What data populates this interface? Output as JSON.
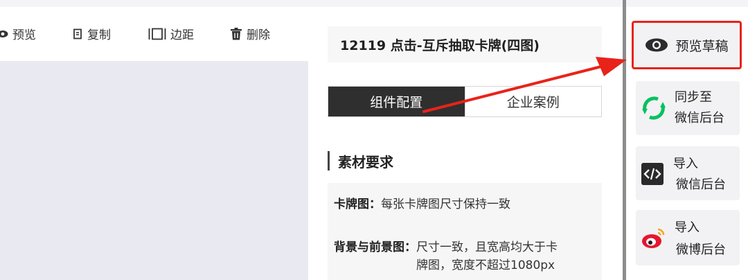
{
  "toolbar": {
    "preview": "预览",
    "copy": "复制",
    "margin": "边距",
    "delete": "删除"
  },
  "title": "12119 点击-互斥抽取卡牌(四图)",
  "tabs": {
    "config": "组件配置",
    "cases": "企业案例"
  },
  "section": {
    "title": "素材要求"
  },
  "requirements": {
    "card_label": "卡牌图：",
    "card_text": "每张卡牌图尺寸保持一致",
    "bg_label": "背景与前景图：",
    "bg_text_1": "尺寸一致，且宽高均大于卡",
    "bg_text_2": "牌图，宽度不超过1080px"
  },
  "sidebar": {
    "preview_draft": "预览草稿",
    "sync_line1": "同步至",
    "sync_line2": "微信后台",
    "import_line1": "导入",
    "import_line2": "微信后台",
    "weibo_line1": "导入",
    "weibo_line2": "微博后台"
  },
  "colors": {
    "highlight": "#e8231a",
    "active_tab": "#2f2f2f",
    "wechat_green": "#07c160",
    "weibo_red": "#e6162d"
  }
}
